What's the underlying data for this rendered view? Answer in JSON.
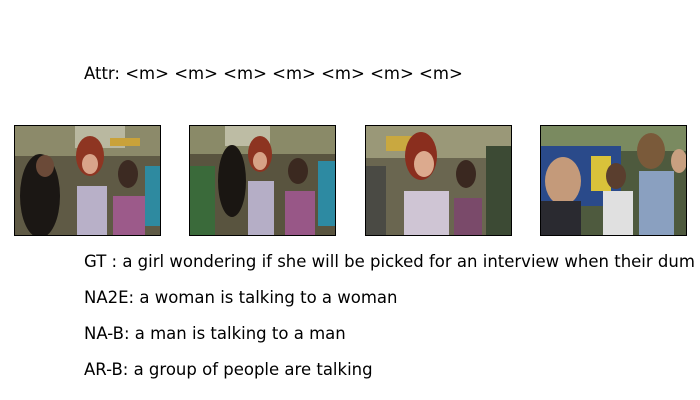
{
  "attr": {
    "label": "Attr: <m> <m> <m> <m> <m> <m> <m>"
  },
  "frames": [
    {
      "description": "video frame 1"
    },
    {
      "description": "video frame 2"
    },
    {
      "description": "video frame 3"
    },
    {
      "description": "video frame 4"
    }
  ],
  "captions": {
    "gt": "GT  : a girl wondering if she will be picked for an interview when their dum",
    "na2e": "NA2E: a woman is talking to a woman",
    "nab": "NA-B: a man is talking to a man",
    "arb": "AR-B: a group of people are talking"
  }
}
